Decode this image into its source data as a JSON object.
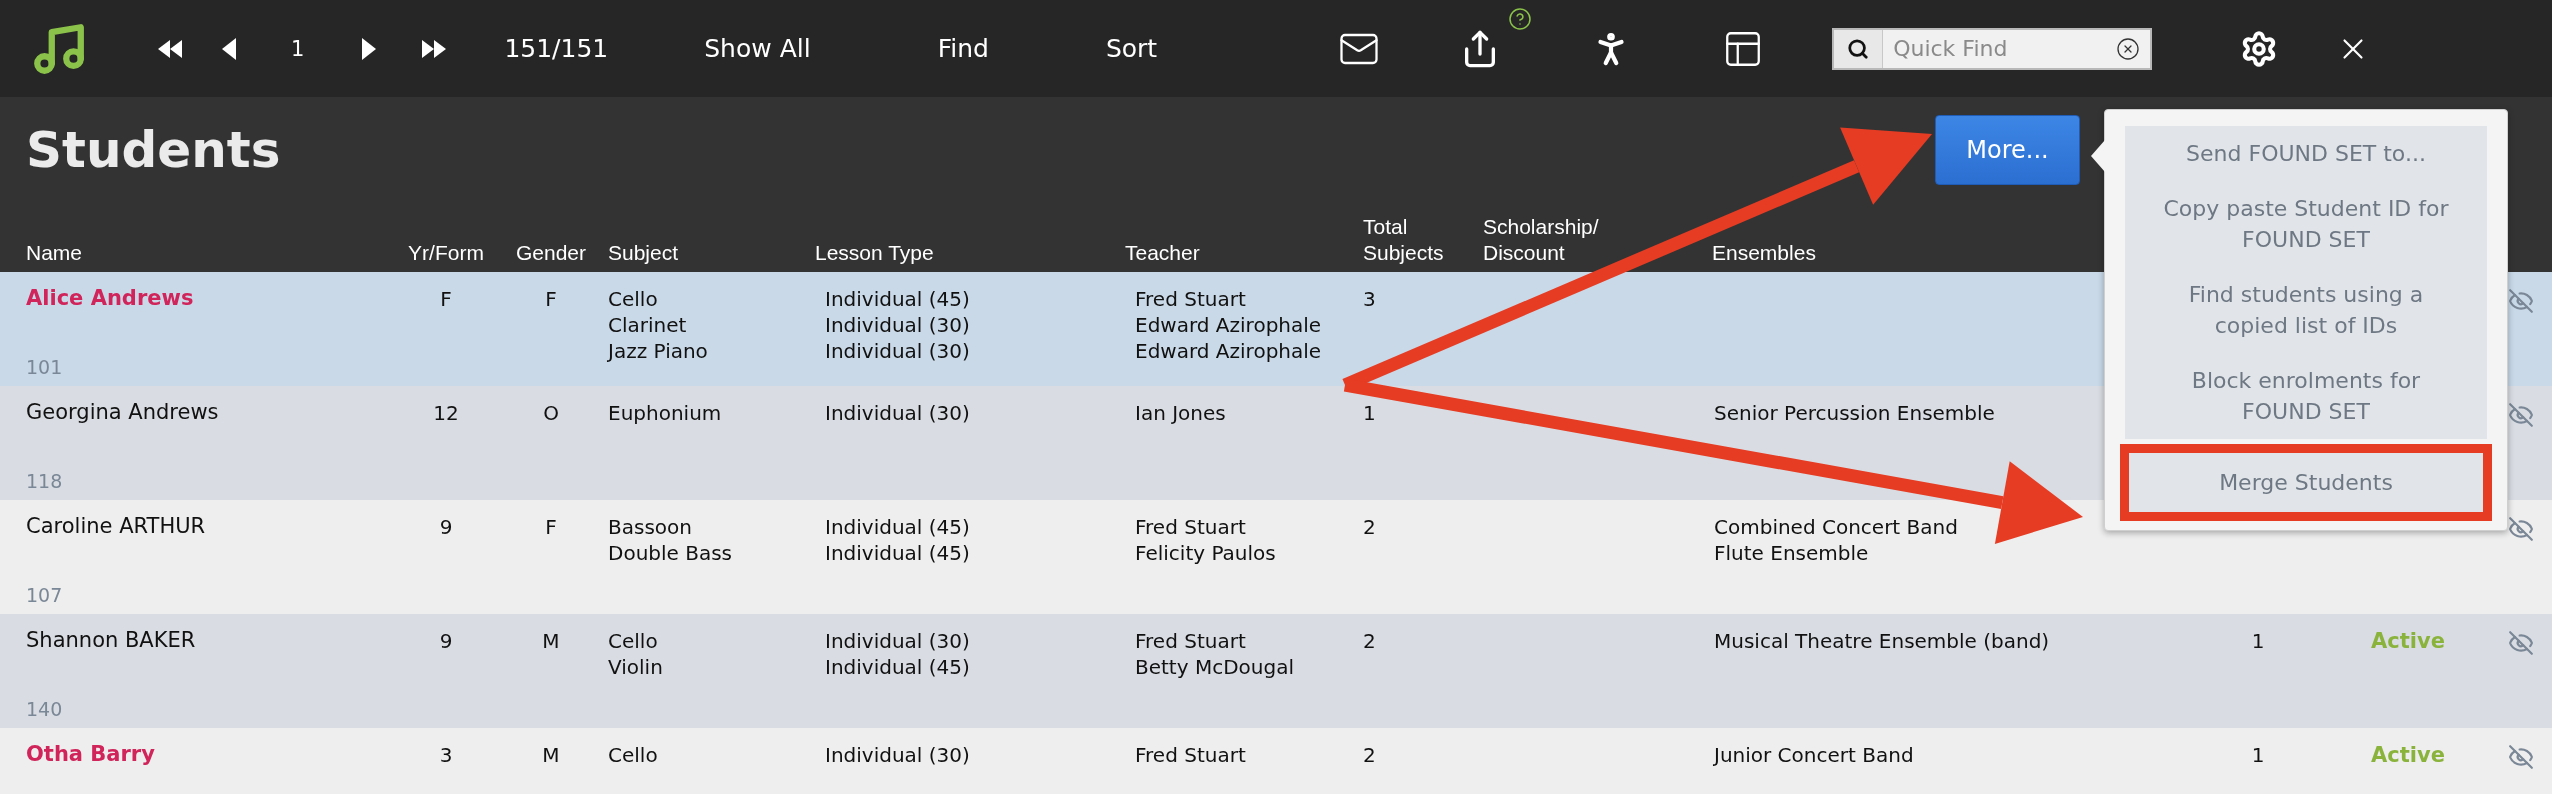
{
  "toolbar": {
    "record": "1",
    "count": "151/151",
    "buttons": [
      "Show All",
      "Find",
      "Sort"
    ],
    "search": {
      "placeholder": "Quick Find"
    }
  },
  "title": "Students",
  "more_button": "More...",
  "columns": [
    "Name",
    "Yr/Form",
    "Gender",
    "Subject",
    "Lesson Type",
    "Teacher",
    "Total Subjects",
    "Scholarship/ Discount",
    "Ensembles"
  ],
  "rows": [
    {
      "name": "Alice Andrews",
      "id": "101",
      "flagged": true,
      "selected": true,
      "yr": "F",
      "gender": "F",
      "subjects": [
        "Cello",
        "Clarinet",
        "Jazz Piano"
      ],
      "lessons": [
        "Individual (45)",
        "Individual (30)",
        "Individual (30)"
      ],
      "teachers": [
        "Fred Stuart",
        "Edward Azirophale",
        "Edward Azirophale"
      ],
      "total": "3",
      "ensembles": []
    },
    {
      "name": "Georgina Andrews",
      "id": "118",
      "flagged": false,
      "selected": false,
      "yr": "12",
      "gender": "O",
      "subjects": [
        "Euphonium"
      ],
      "lessons": [
        "Individual (30)"
      ],
      "teachers": [
        "Ian Jones"
      ],
      "total": "1",
      "ensembles": [
        "Senior Percussion Ensemble"
      ]
    },
    {
      "name": "Caroline ARTHUR",
      "id": "107",
      "flagged": false,
      "selected": false,
      "yr": "9",
      "gender": "F",
      "subjects": [
        "Bassoon",
        "Double Bass"
      ],
      "lessons": [
        "Individual (45)",
        "Individual (45)"
      ],
      "teachers": [
        "Fred Stuart",
        "Felicity Paulos"
      ],
      "total": "2",
      "ensembles": [
        "Combined Concert Band",
        "Flute Ensemble"
      ]
    },
    {
      "name": "Shannon BAKER",
      "id": "140",
      "flagged": false,
      "selected": false,
      "yr": "9",
      "gender": "M",
      "subjects": [
        "Cello",
        "Violin"
      ],
      "lessons": [
        "Individual (30)",
        "Individual (45)"
      ],
      "teachers": [
        "Fred Stuart",
        "Betty McDougal"
      ],
      "total": "2",
      "ensembles": [
        "Musical Theatre Ensemble (band)"
      ],
      "column_10": "1",
      "status": "Active"
    },
    {
      "name": "Otha Barry",
      "flagged": true,
      "selected": false,
      "yr": "3",
      "gender": "M",
      "subjects": [
        "Cello"
      ],
      "lessons": [
        "Individual (30)"
      ],
      "teachers": [
        "Fred Stuart"
      ],
      "total": "2",
      "ensembles": [
        "Junior Concert Band"
      ],
      "column_10": "1",
      "status": "Active"
    }
  ],
  "menu": {
    "items": [
      {
        "label": "Send FOUND SET to...",
        "outlined": false
      },
      {
        "label": "Copy paste Student ID for FOUND SET",
        "outlined": false
      },
      {
        "label": "Find students using a copied list of IDs",
        "outlined": false
      },
      {
        "label": "Block enrolments for FOUND SET",
        "outlined": false
      },
      {
        "label": "Merge Students",
        "outlined": true
      }
    ]
  }
}
